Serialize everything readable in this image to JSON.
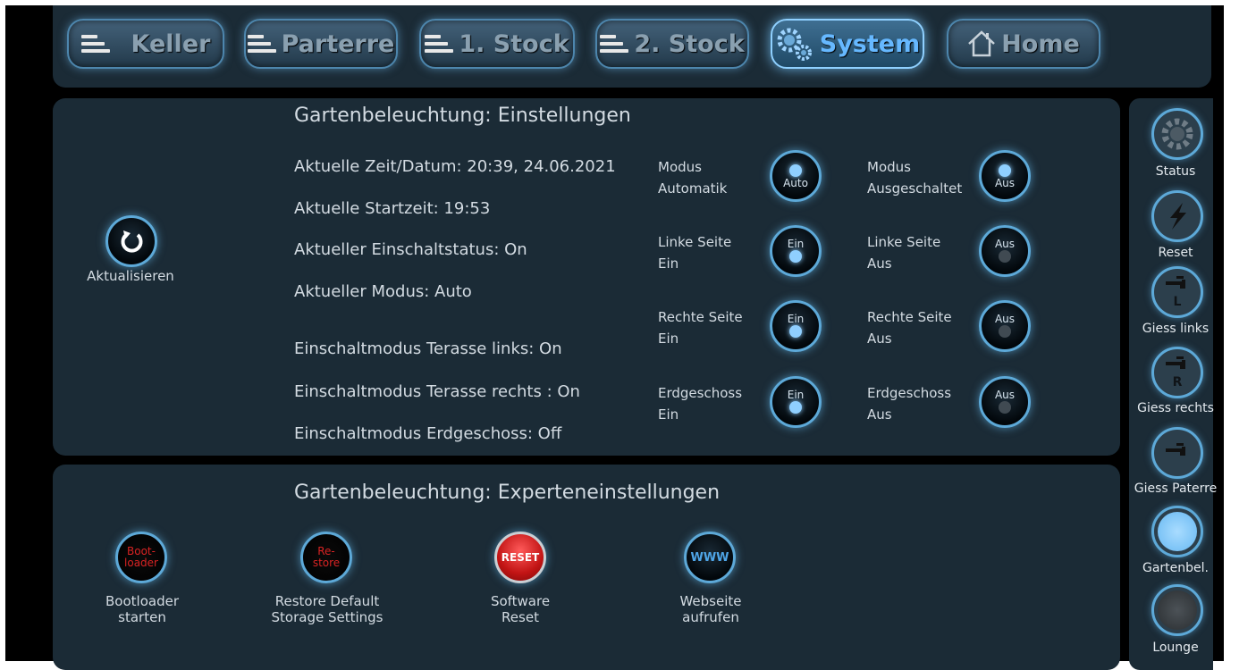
{
  "nav": [
    {
      "label": "Keller",
      "icon": "floor-stack-icon"
    },
    {
      "label": "Parterre",
      "icon": "floor-stack-icon"
    },
    {
      "label": "1. Stock",
      "icon": "floor-stack-icon"
    },
    {
      "label": "2. Stock",
      "icon": "floor-stack-icon"
    },
    {
      "label": "System",
      "icon": "gear-icon",
      "active": true
    },
    {
      "label": "Home",
      "icon": "home-icon"
    }
  ],
  "settings": {
    "title": "Gartenbeleuchtung: Einstellungen",
    "refresh_label": "Aktualisieren",
    "info": [
      "Aktuelle Zeit/Datum: 20:39, 24.06.2021",
      "Aktuelle Startzeit: 19:53",
      "Aktueller Einschaltstatus: On",
      "Aktueller Modus: Auto",
      "Einschaltmodus Terasse links: On",
      "Einschaltmodus Terasse rechts : On",
      "Einschaltmodus Erdgeschoss:  Off"
    ],
    "controls": [
      {
        "line1": "Modus",
        "line2": "Automatik",
        "button": "Auto"
      },
      {
        "line1": "Modus",
        "line2": "Ausgeschaltet",
        "button": "Aus"
      },
      {
        "line1": "Linke Seite",
        "line2": "Ein",
        "button": "Ein"
      },
      {
        "line1": "Linke Seite",
        "line2": "Aus",
        "button": "Aus"
      },
      {
        "line1": "Rechte Seite",
        "line2": "Ein",
        "button": "Ein"
      },
      {
        "line1": "Rechte Seite",
        "line2": "Aus",
        "button": "Aus"
      },
      {
        "line1": "Erdgeschoss",
        "line2": "Ein",
        "button": "Ein"
      },
      {
        "line1": "Erdgeschoss",
        "line2": "Aus",
        "button": "Aus"
      }
    ]
  },
  "expert": {
    "title": "Gartenbeleuchtung: Experteneinstellungen",
    "items": [
      {
        "btn1": "Boot-",
        "btn2": "loader",
        "line1": "Bootloader",
        "line2": "starten"
      },
      {
        "btn1": "Re-",
        "btn2": "store",
        "line1": "Restore Default",
        "line2": "Storage  Settings"
      },
      {
        "btn1": "RESET",
        "btn2": "",
        "line1": "Software",
        "line2": "Reset"
      },
      {
        "btn1": "WWW",
        "btn2": "",
        "line1": "Webseite",
        "line2": "aufrufen"
      }
    ]
  },
  "sidebar": [
    {
      "label": "Status",
      "icon": "gear-icon"
    },
    {
      "label": "Reset",
      "icon": "lightning-icon"
    },
    {
      "label": "Giess links",
      "icon": "faucet-icon",
      "letter": "L"
    },
    {
      "label": "Giess  rechts",
      "icon": "faucet-icon",
      "letter": "R"
    },
    {
      "label": "Giess Paterre",
      "icon": "faucet-icon"
    },
    {
      "label": "Gartenbel.",
      "icon": "bulb-on-icon"
    },
    {
      "label": "Lounge",
      "icon": "bulb-off-icon"
    }
  ],
  "colors": {
    "accent": "#5da9d8",
    "active_text": "#66b8ff",
    "panel": "#1b2b36",
    "bulb_on": "#8fcfff",
    "reset_red": "#d8262a",
    "bootloader_red": "#cc1a1a"
  }
}
